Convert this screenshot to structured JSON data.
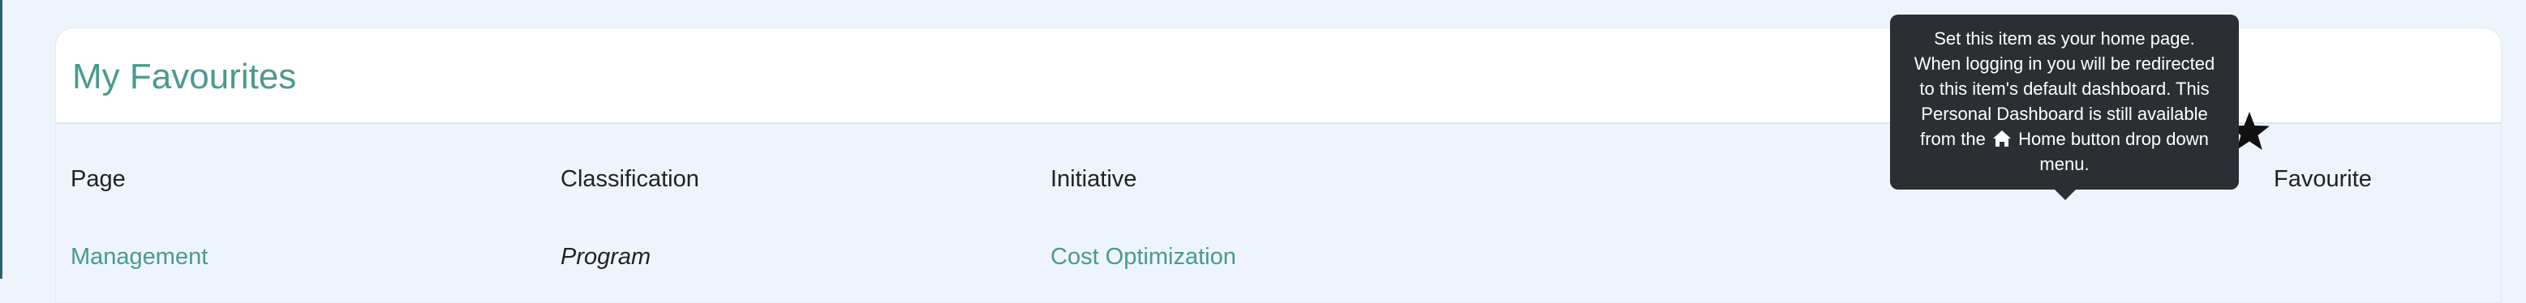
{
  "card": {
    "title": "My Favourites"
  },
  "table": {
    "headers": {
      "page": "Page",
      "classification": "Classification",
      "initiative": "Initiative",
      "favourite": "Favourite"
    },
    "rows": [
      {
        "page": "Management",
        "classification": "Program",
        "initiative": "Cost Optimization",
        "home_icon": "home-icon",
        "favourite_icon": "star-filled-icon"
      }
    ]
  },
  "tooltip": {
    "line1": "Set this item as your home page.",
    "line2": "When logging in you will be redirected",
    "line3": "to this item's default dashboard. This",
    "line4": "Personal Dashboard is still available",
    "line5_before": "from the",
    "line5_after": "Home button drop down",
    "line6": "menu."
  },
  "colors": {
    "accent": "#4a9a8e",
    "background": "#eef4fc",
    "tooltip_bg": "#2b2f33",
    "icon_gray": "#666666"
  }
}
